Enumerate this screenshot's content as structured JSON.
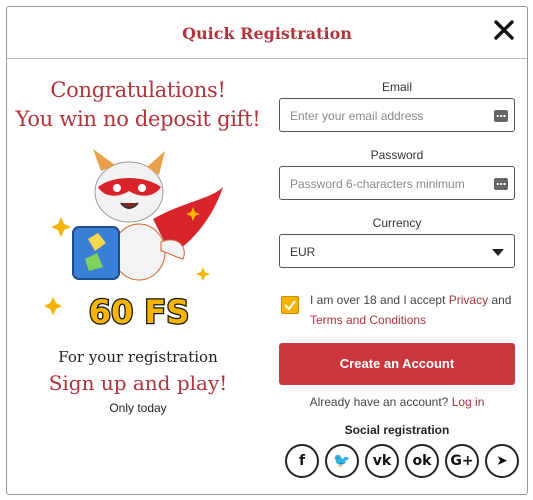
{
  "header": {
    "title": "Quick Registration",
    "close_icon": "close-icon"
  },
  "promo": {
    "line1": "Congratulations!",
    "line2": "You win no deposit gift!",
    "badge": "60 FS",
    "reg_line1": "For your registration",
    "reg_line2": "Sign up and play!",
    "reg_line3": "Only today"
  },
  "form": {
    "email_label": "Email",
    "email_placeholder": "Enter your email address",
    "password_label": "Password",
    "password_placeholder": "Password 6-characters minimum",
    "currency_label": "Currency",
    "currency_value": "EUR",
    "terms_prefix": "I am over 18 and I accept",
    "privacy_link": "Privacy",
    "terms_and": "and",
    "terms_link": "Terms and Conditions",
    "create_button": "Create an Account",
    "have_account": "Already have an account?",
    "login_link": "Log in",
    "social_title": "Social registration"
  },
  "social": [
    {
      "name": "facebook-icon",
      "glyph": "f"
    },
    {
      "name": "twitter-icon",
      "glyph": "🐦"
    },
    {
      "name": "vk-icon",
      "glyph": "vk"
    },
    {
      "name": "odnoklassniki-icon",
      "glyph": "ok"
    },
    {
      "name": "google-plus-icon",
      "glyph": "G+"
    },
    {
      "name": "telegram-icon",
      "glyph": "➤"
    }
  ],
  "colors": {
    "accent": "#c9373d",
    "title": "#b0343b",
    "checkbox": "#f5b400"
  }
}
